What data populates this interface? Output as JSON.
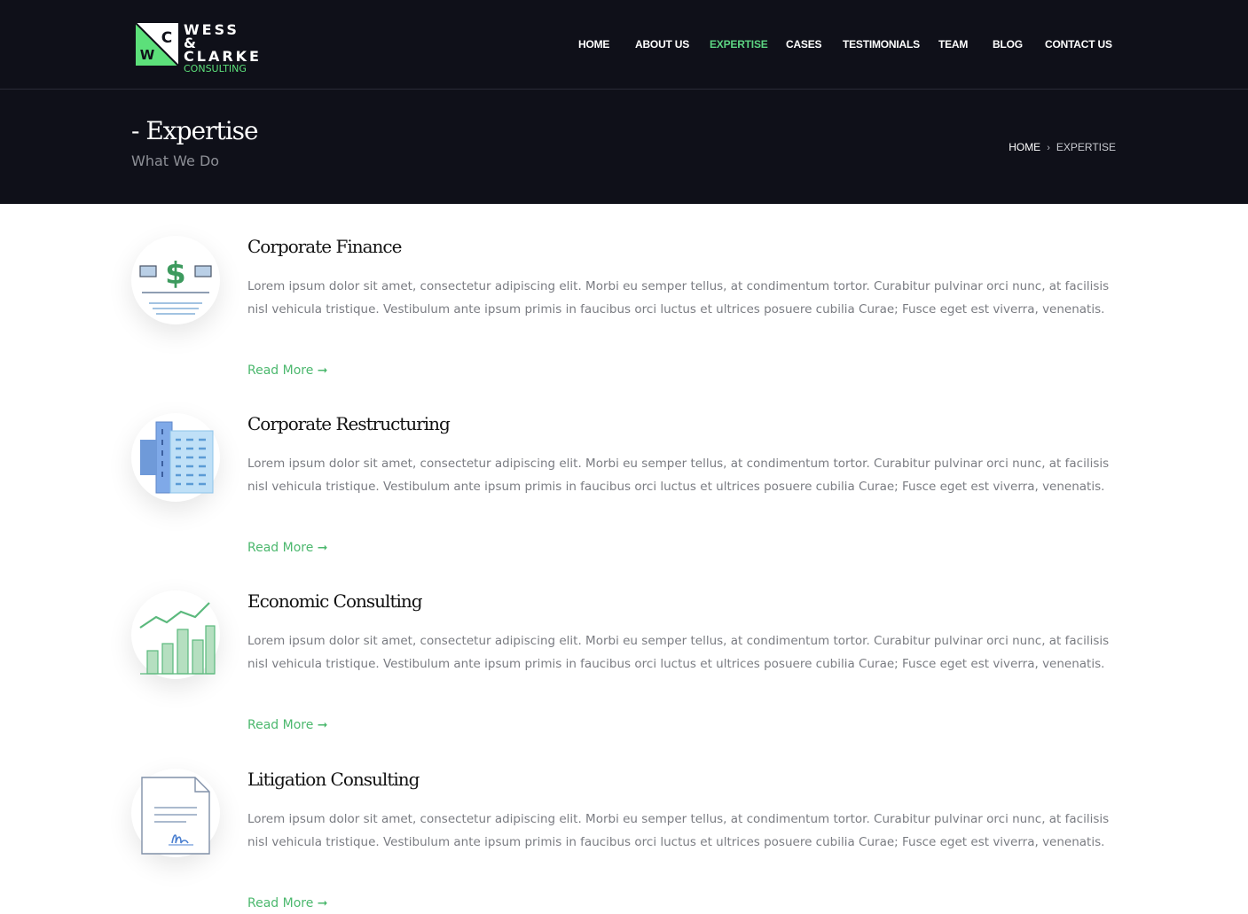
{
  "brand": {
    "line1": "WESS &",
    "line2": "CLARKE",
    "line3": "CONSULTING",
    "mark_c": "C",
    "mark_w": "W",
    "accent": "#5ce07a"
  },
  "nav": {
    "items": [
      {
        "label": "HOME"
      },
      {
        "label": "ABOUT US"
      },
      {
        "label": "EXPERTISE",
        "active": true
      },
      {
        "label": "CASES"
      },
      {
        "label": "TESTIMONIALS"
      },
      {
        "label": "TEAM"
      },
      {
        "label": "BLOG"
      },
      {
        "label": "CONTACT US"
      }
    ]
  },
  "header": {
    "title": "- Expertise",
    "subtitle": "What We Do",
    "breadcrumb": {
      "home": "HOME",
      "separator": "›",
      "current": "EXPERTISE"
    }
  },
  "services": [
    {
      "title": "Corporate Finance",
      "icon": "money-check-icon",
      "text": "Lorem ipsum dolor sit amet, consectetur adipiscing elit. Morbi eu semper tellus, at condimentum tortor. Curabitur pulvinar orci nunc, at facilisis nisl vehicula tristique. Vestibulum ante ipsum primis in faucibus orci luctus et ultrices posuere cubilia Curae; Fusce eget est viverra, venenatis.",
      "more": "Read More ➞"
    },
    {
      "title": "Corporate Restructuring",
      "icon": "office-buildings-icon",
      "text": "Lorem ipsum dolor sit amet, consectetur adipiscing elit. Morbi eu semper tellus, at condimentum tortor. Curabitur pulvinar orci nunc, at facilisis nisl vehicula tristique. Vestibulum ante ipsum primis in faucibus orci luctus et ultrices posuere cubilia Curae; Fusce eget est viverra, venenatis.",
      "more": "Read More ➞"
    },
    {
      "title": "Economic Consulting",
      "icon": "bar-chart-icon",
      "text": "Lorem ipsum dolor sit amet, consectetur adipiscing elit. Morbi eu semper tellus, at condimentum tortor. Curabitur pulvinar orci nunc, at facilisis nisl vehicula tristique. Vestibulum ante ipsum primis in faucibus orci luctus et ultrices posuere cubilia Curae; Fusce eget est viverra, venenatis.",
      "more": "Read More ➞"
    },
    {
      "title": "Litigation Consulting",
      "icon": "signed-document-icon",
      "text": "Lorem ipsum dolor sit amet, consectetur adipiscing elit. Morbi eu semper tellus, at condimentum tortor. Curabitur pulvinar orci nunc, at facilisis nisl vehicula tristique. Vestibulum ante ipsum primis in faucibus orci luctus et ultrices posuere cubilia Curae; Fusce eget est viverra, venenatis.",
      "more": "Read More ➞"
    }
  ]
}
